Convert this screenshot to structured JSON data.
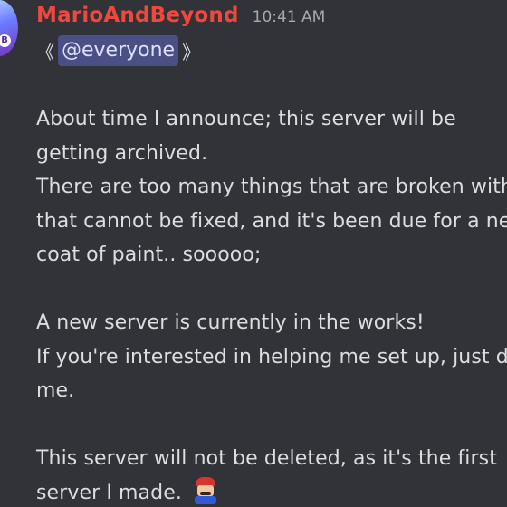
{
  "message": {
    "author": "MarioAndBeyond",
    "timestamp": "10:41 AM",
    "mention": {
      "open_bracket": "《",
      "text": "@everyone",
      "close_bracket": "》"
    },
    "lines": [
      "About time I announce; this server will be",
      "getting archived.",
      "There are too many things that are broken with",
      "that cannot be fixed, and it's been due for a ne",
      "coat of paint.. sooooo;",
      "",
      "A new server is currently in the works!",
      "If you're interested in helping me set up, just d",
      "me.",
      "",
      "This server will not be deleted, as it's the first",
      "server I made."
    ]
  },
  "icons": {
    "avatar": "user-avatar",
    "emoji": "mario-emoji"
  },
  "colors": {
    "background": "#313338",
    "username": "#f0473f",
    "timestamp": "#a7a9ad",
    "text": "#dbdee1",
    "mention_bg": "#4a4f86",
    "mention_text": "#dee0fc"
  }
}
